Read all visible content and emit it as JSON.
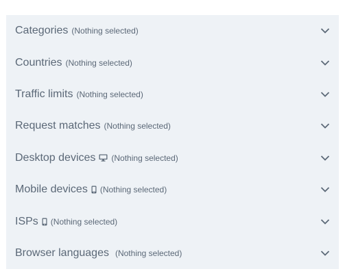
{
  "filters": [
    {
      "title": "Categories",
      "status": "(Nothing selected)",
      "icon": null
    },
    {
      "title": "Countries",
      "status": "(Nothing selected)",
      "icon": null
    },
    {
      "title": "Traffic limits",
      "status": "(Nothing selected)",
      "icon": null
    },
    {
      "title": "Request matches",
      "status": "(Nothing selected)",
      "icon": null
    },
    {
      "title": "Desktop devices",
      "status": "(Nothing selected)",
      "icon": "desktop-icon"
    },
    {
      "title": "Mobile devices",
      "status": "(Nothing selected)",
      "icon": "mobile-icon"
    },
    {
      "title": "ISPs",
      "status": "(Nothing selected)",
      "icon": "mobile-icon"
    },
    {
      "title": "Browser languages",
      "status": "(Nothing selected)",
      "icon": null
    }
  ],
  "colors": {
    "panel_background": "#eef2f6",
    "text": "#5b6877",
    "chevron": "#5b6877"
  }
}
